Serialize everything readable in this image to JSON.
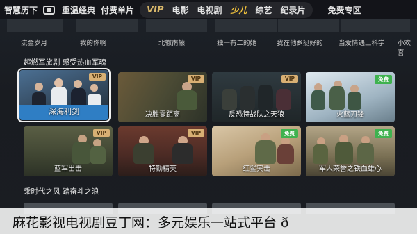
{
  "nav": {
    "items": [
      "智慧历下",
      "重温经典",
      "付费单片"
    ],
    "pill": [
      "VIP",
      "电影",
      "电视剧",
      "少儿",
      "综艺",
      "纪录片"
    ],
    "right": "免费专区"
  },
  "top_row": {
    "captions": [
      "流金岁月",
      "我的你啊",
      "北辙南辕",
      "独一有二的她",
      "我在他乡挺好的",
      "当爱情遇上科学",
      "小欢喜"
    ]
  },
  "section1": {
    "title": "超燃军旅剧 感受热血军魂",
    "row1": [
      {
        "title": "深海利剑",
        "badge": "VIP"
      },
      {
        "title": "决胜零距离",
        "badge": "VIP"
      },
      {
        "title": "反恐特战队之天狼",
        "badge": "VIP"
      },
      {
        "title": "火蓝刀锋",
        "badge": "免费"
      }
    ],
    "row2": [
      {
        "title": "蓝军出击",
        "badge": "VIP"
      },
      {
        "title": "特勤精英",
        "badge": "VIP"
      },
      {
        "title": "红鲨突击",
        "badge": "免费"
      },
      {
        "title": "军人荣誉之铁血雄心",
        "badge": "免费"
      }
    ]
  },
  "section2": {
    "title": "乘时代之风 踏奋斗之浪"
  },
  "caption": {
    "text": "麻花影视电视剧豆丁网：多元娱乐一站式平台 ð"
  }
}
